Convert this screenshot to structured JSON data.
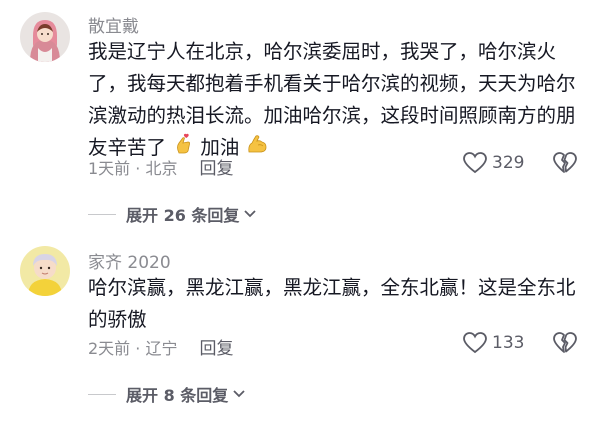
{
  "comments": [
    {
      "username": "散宜戴",
      "text": "我是辽宁人在北京，哈尔滨委屈时，我哭了，哈尔滨火了，我每天都抱着手机看关于哈尔滨的视频，天天为哈尔滨激动的热泪长流。加油哈尔滨，这段时间照顾南方的朋友辛苦了",
      "text_tail": "加油",
      "time_location": "1天前 · 北京",
      "reply_label": "回复",
      "likes": "329",
      "expand_label": "展开 26 条回复",
      "avatar": "girl-avatar",
      "emoji_1": "hand-heart-emoji",
      "emoji_2": "flexed-biceps-emoji"
    },
    {
      "username": "家齐 2020",
      "text": "哈尔滨赢，黑龙江赢，黑龙江赢，全东北赢！这是全东北的骄傲",
      "time_location": "2天前 · 辽宁",
      "reply_label": "回复",
      "likes": "133",
      "expand_label": "展开 8 条回复",
      "avatar": "boy-avatar"
    }
  ],
  "colors": {
    "text": "#161823",
    "muted": "#8a8b91",
    "action": "#5b5c66",
    "emoji_yellow": "#f5c242"
  }
}
